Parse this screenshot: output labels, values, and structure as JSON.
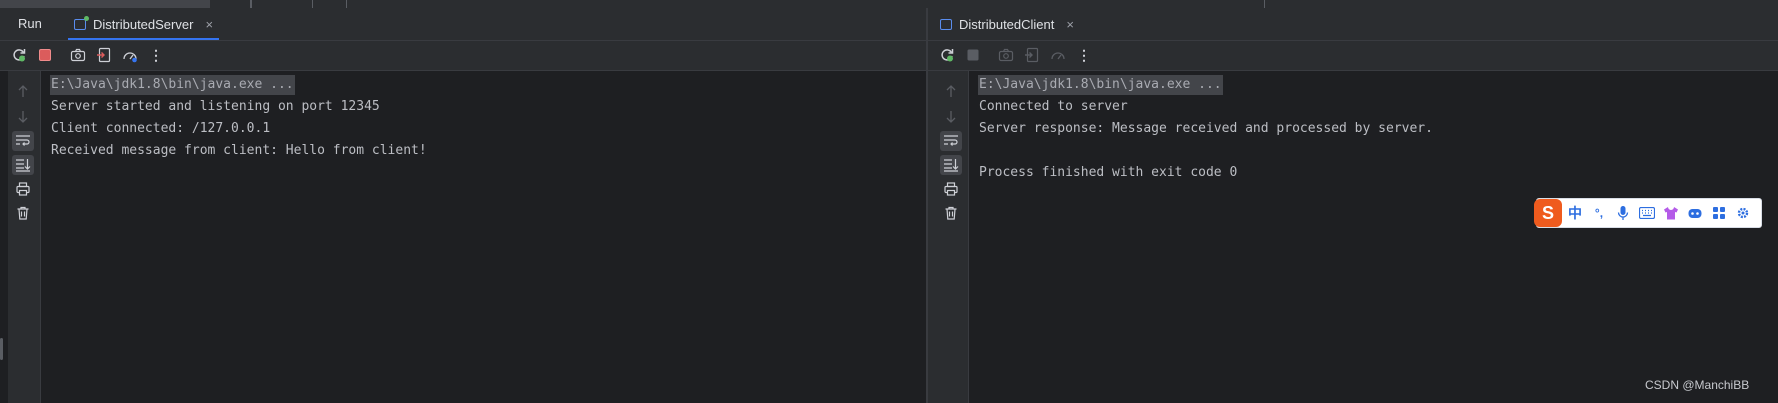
{
  "run_panel": {
    "label": "Run"
  },
  "tabs": {
    "server": {
      "label": "DistributedServer",
      "close": "×"
    },
    "client": {
      "label": "DistributedClient",
      "close": "×"
    }
  },
  "toolbar": {
    "more": "⋮"
  },
  "server_console": {
    "lines": [
      "E:\\Java\\jdk1.8\\bin\\java.exe ...",
      "Server started and listening on port 12345",
      "Client connected: /127.0.0.1",
      "Received message from client: Hello from client!"
    ]
  },
  "client_console": {
    "lines": [
      "E:\\Java\\jdk1.8\\bin\\java.exe ...",
      "Connected to server",
      "Server response: Message received and processed by server.",
      "",
      "Process finished with exit code 0"
    ]
  },
  "ime_toolbar": {
    "logo": "S",
    "mode": "中",
    "punct": "°,"
  },
  "watermark": "CSDN @ManchiBB",
  "colors": {
    "accent": "#3574f0",
    "stop_active": "#db5c5c",
    "rerun": "#5fb865",
    "ime_brand": "#ef5b1e"
  }
}
